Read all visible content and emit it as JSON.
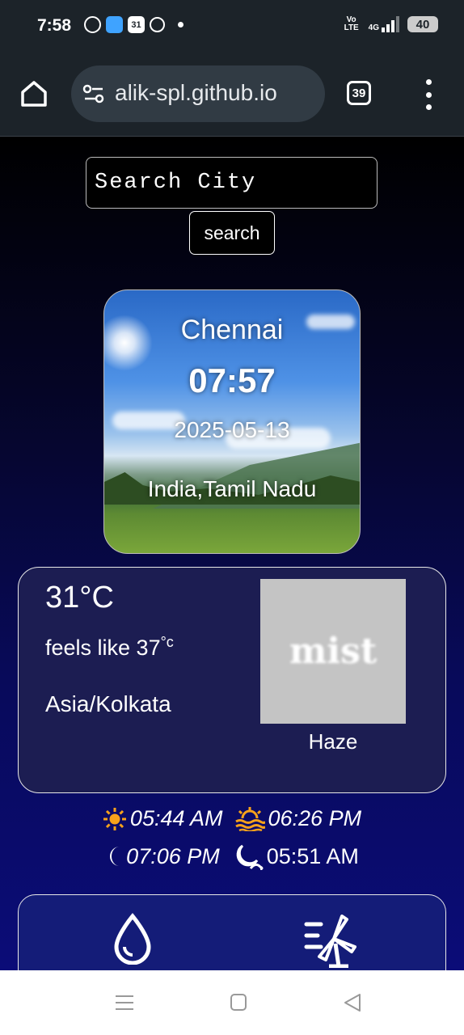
{
  "status_bar": {
    "time": "7:58",
    "calendar_badge": "31",
    "network": "4G",
    "volte": "Vo LTE",
    "battery": "40"
  },
  "browser": {
    "url": "alik-spl.github.io",
    "tab_count": "39"
  },
  "search": {
    "placeholder": "Search City",
    "button_label": "search"
  },
  "city_card": {
    "city": "Chennai",
    "time": "07:57",
    "date": "2025-05-13",
    "region": "India,Tamil Nadu"
  },
  "weather": {
    "temperature": "31",
    "temperature_unit": "°C",
    "feels_like_label": "feels like 37",
    "feels_like_unit": "°c",
    "timezone": "Asia/Kolkata",
    "image_text": "mist",
    "condition": "Haze"
  },
  "sun_moon": {
    "sunrise": "05:44 AM",
    "sunset": "06:26 PM",
    "moonrise": "07:06 PM",
    "moonset": "05:51 AM"
  },
  "icons": {
    "sunrise": "sun-icon",
    "sunset": "sunset-icon",
    "moonrise": "moon-icon",
    "moonset": "moonset-icon",
    "humidity": "humidity-drop-icon",
    "wind": "wind-turbine-icon"
  },
  "colors": {
    "accent_sun": "#f7a21b",
    "card_bg": "#1c1d52",
    "page_bottom": "#0b0c78"
  }
}
